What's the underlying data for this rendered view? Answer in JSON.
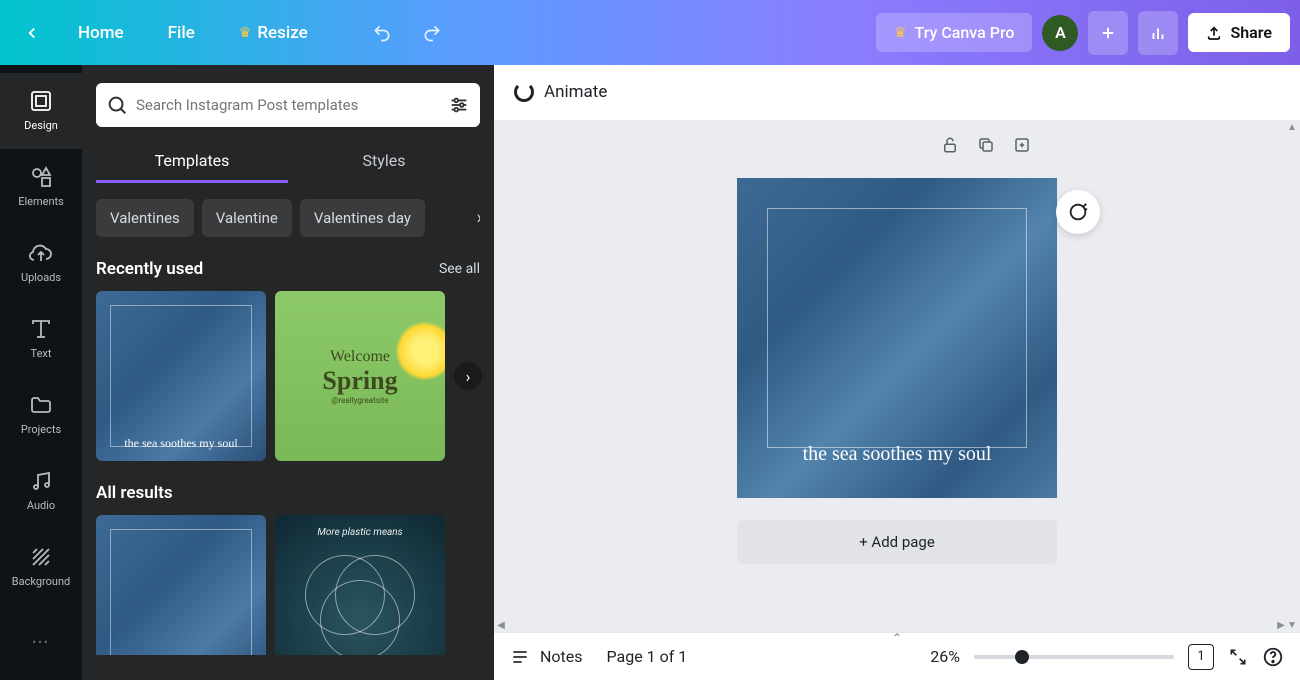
{
  "topbar": {
    "home": "Home",
    "file": "File",
    "resize": "Resize",
    "try_pro": "Try Canva Pro",
    "share": "Share",
    "avatar_initial": "A"
  },
  "rail": {
    "items": [
      {
        "label": "Design"
      },
      {
        "label": "Elements"
      },
      {
        "label": "Uploads"
      },
      {
        "label": "Text"
      },
      {
        "label": "Projects"
      },
      {
        "label": "Audio"
      },
      {
        "label": "Background"
      }
    ]
  },
  "panel": {
    "search_placeholder": "Search Instagram Post templates",
    "tabs": {
      "templates": "Templates",
      "styles": "Styles"
    },
    "chips": [
      "Valentines",
      "Valentine",
      "Valentines day"
    ],
    "recently_used": {
      "title": "Recently used",
      "see_all": "See all"
    },
    "all_results": {
      "title": "All results"
    },
    "thumb_sea_caption": "the sea soothes my soul",
    "thumb_spring": {
      "welcome": "Welcome",
      "spring": "Spring",
      "handle": "@reallygreatsite"
    },
    "thumb_ocean_text": "More plastic means"
  },
  "canvas": {
    "animate": "Animate",
    "page_text": "the sea soothes my soul",
    "add_page": "+ Add page"
  },
  "footer": {
    "notes": "Notes",
    "page_label": "Page 1 of 1",
    "zoom": "26%",
    "page_count": "1"
  }
}
